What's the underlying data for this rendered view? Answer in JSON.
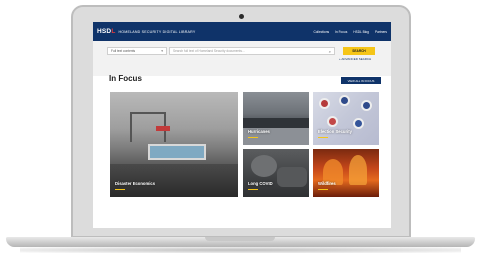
{
  "header": {
    "logo_mark_prefix": "HSD",
    "logo_mark_suffix": "L",
    "logo_text": "HOMELAND SECURITY DIGITAL LIBRARY",
    "nav": [
      "Collections",
      "In Focus",
      "HSDL Blog",
      "Partners"
    ]
  },
  "search": {
    "collection_label": "Full text contents",
    "query_placeholder": "Search full text of Homeland Security documents...",
    "button_label": "SEARCH",
    "advanced_link": "ADVANCED SEARCH"
  },
  "infocus": {
    "title": "In Focus",
    "view_all_label": "VIEW ALL IN FOCUS",
    "tiles": [
      {
        "label": "Disaster Economics"
      },
      {
        "label": "Hurricanes"
      },
      {
        "label": "Election Security"
      },
      {
        "label": "Long COVID"
      },
      {
        "label": "Wildfires"
      }
    ]
  },
  "colors": {
    "header_bg": "#0f3369",
    "accent_yellow": "#f5c518",
    "logo_red": "#e23b3b"
  },
  "icons": {
    "search": "search-icon",
    "dropdown": "chevron-down-icon"
  }
}
